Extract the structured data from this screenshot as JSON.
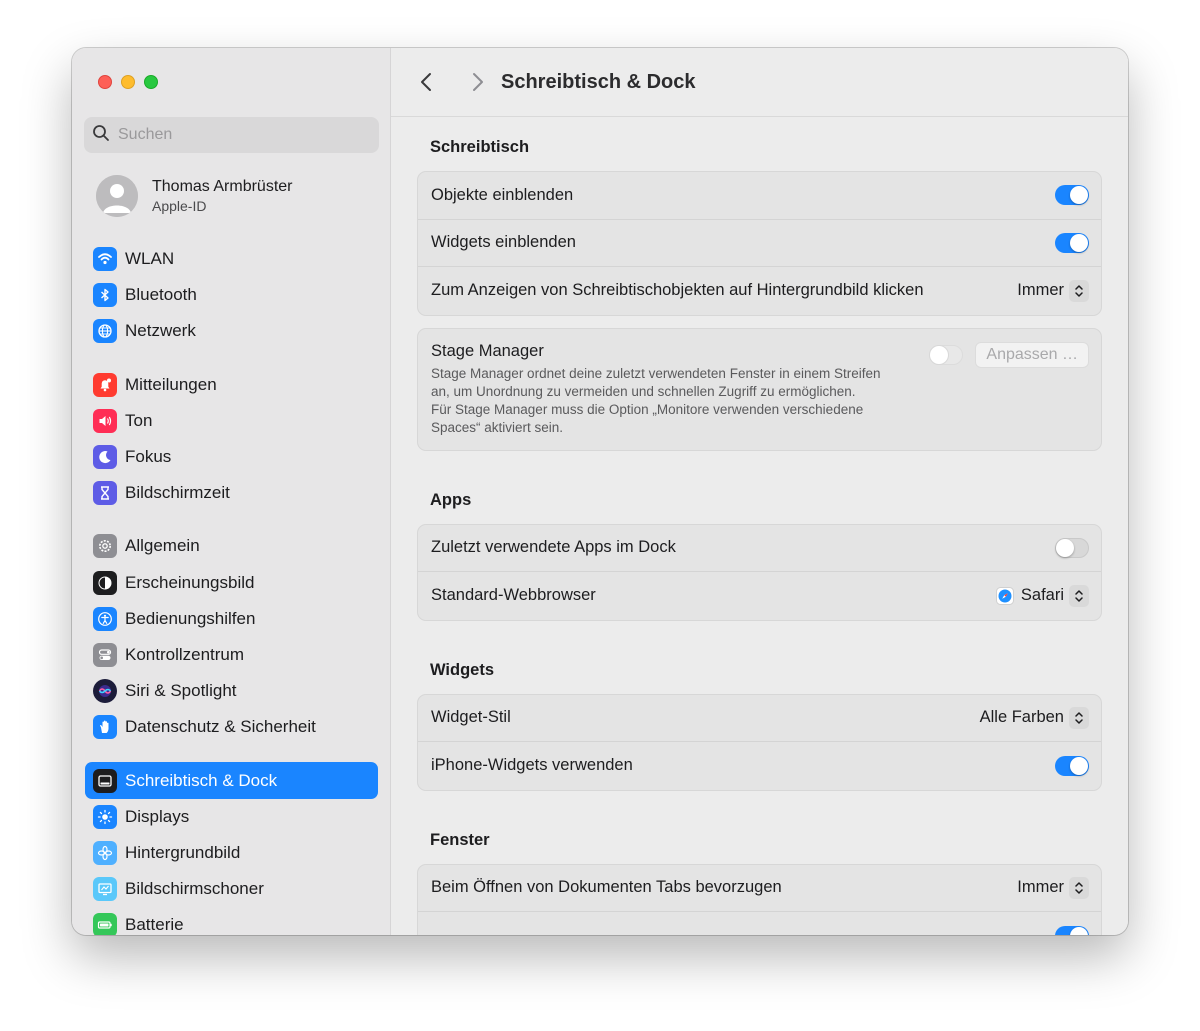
{
  "sidebar": {
    "search_placeholder": "Suchen",
    "account": {
      "name": "Thomas Armbrüster",
      "subtitle": "Apple-ID"
    },
    "groups": [
      [
        {
          "label": "WLAN",
          "icon": "wifi-icon",
          "color": "#1a85ff"
        },
        {
          "label": "Bluetooth",
          "icon": "bluetooth-icon",
          "color": "#1a85ff"
        },
        {
          "label": "Netzwerk",
          "icon": "globe-icon",
          "color": "#1a85ff"
        }
      ],
      [
        {
          "label": "Mitteilungen",
          "icon": "bell-icon",
          "color": "#ff3b30"
        },
        {
          "label": "Ton",
          "icon": "speaker-icon",
          "color": "#ff2d55"
        },
        {
          "label": "Fokus",
          "icon": "moon-icon",
          "color": "#5e5ce6"
        },
        {
          "label": "Bildschirmzeit",
          "icon": "hourglass-icon",
          "color": "#5e5ce6"
        }
      ],
      [
        {
          "label": "Allgemein",
          "icon": "gear-icon",
          "color": "#8e8e93"
        },
        {
          "label": "Erscheinungsbild",
          "icon": "appearance-icon",
          "color": "#1d1d1f"
        },
        {
          "label": "Bedienungshilfen",
          "icon": "accessibility-icon",
          "color": "#1a85ff"
        },
        {
          "label": "Kontrollzentrum",
          "icon": "control-center-icon",
          "color": "#8e8e93"
        },
        {
          "label": "Siri & Spotlight",
          "icon": "siri-icon",
          "color": "#2b2b6e"
        },
        {
          "label": "Datenschutz & Sicherheit",
          "icon": "hand-icon",
          "color": "#1a85ff"
        }
      ],
      [
        {
          "label": "Schreibtisch & Dock",
          "icon": "dock-icon",
          "color": "#1d1d1f",
          "active": true
        },
        {
          "label": "Displays",
          "icon": "sun-icon",
          "color": "#1a85ff"
        },
        {
          "label": "Hintergrundbild",
          "icon": "flower-icon",
          "color": "#4fb0ff"
        },
        {
          "label": "Bildschirmschoner",
          "icon": "screensaver-icon",
          "color": "#5ac8fa"
        },
        {
          "label": "Batterie",
          "icon": "battery-icon",
          "color": "#34c759"
        }
      ]
    ]
  },
  "header": {
    "title": "Schreibtisch & Dock"
  },
  "sections": {
    "desktop": {
      "title": "Schreibtisch",
      "row1": "Objekte einblenden",
      "row2": "Widgets einblenden",
      "row3": "Zum Anzeigen von Schreibtischobjekten auf Hintergrundbild klicken",
      "row3_value": "Immer"
    },
    "stage": {
      "title": "Stage Manager",
      "desc1": "Stage Manager ordnet deine zuletzt verwendeten Fenster in einem Streifen an, um Unordnung zu vermeiden und schnellen Zugriff zu ermöglichen.",
      "desc2": "Für Stage Manager muss die Option „Monitore verwenden verschiedene Spaces“ aktiviert sein.",
      "button": "Anpassen …"
    },
    "apps": {
      "title": "Apps",
      "row1": "Zuletzt verwendete Apps im Dock",
      "row2": "Standard-Webbrowser",
      "row2_value": "Safari"
    },
    "widgets": {
      "title": "Widgets",
      "row1": "Widget-Stil",
      "row1_value": "Alle Farben",
      "row2": "iPhone-Widgets verwenden"
    },
    "windows": {
      "title": "Fenster",
      "row1": "Beim Öffnen von Dokumenten Tabs bevorzugen",
      "row1_value": "Immer"
    }
  },
  "toggles": {
    "objects": true,
    "widgets": true,
    "stage_manager": false,
    "recent_apps": false,
    "iphone_widgets": true
  },
  "colors": {
    "accent": "#1a85ff"
  }
}
